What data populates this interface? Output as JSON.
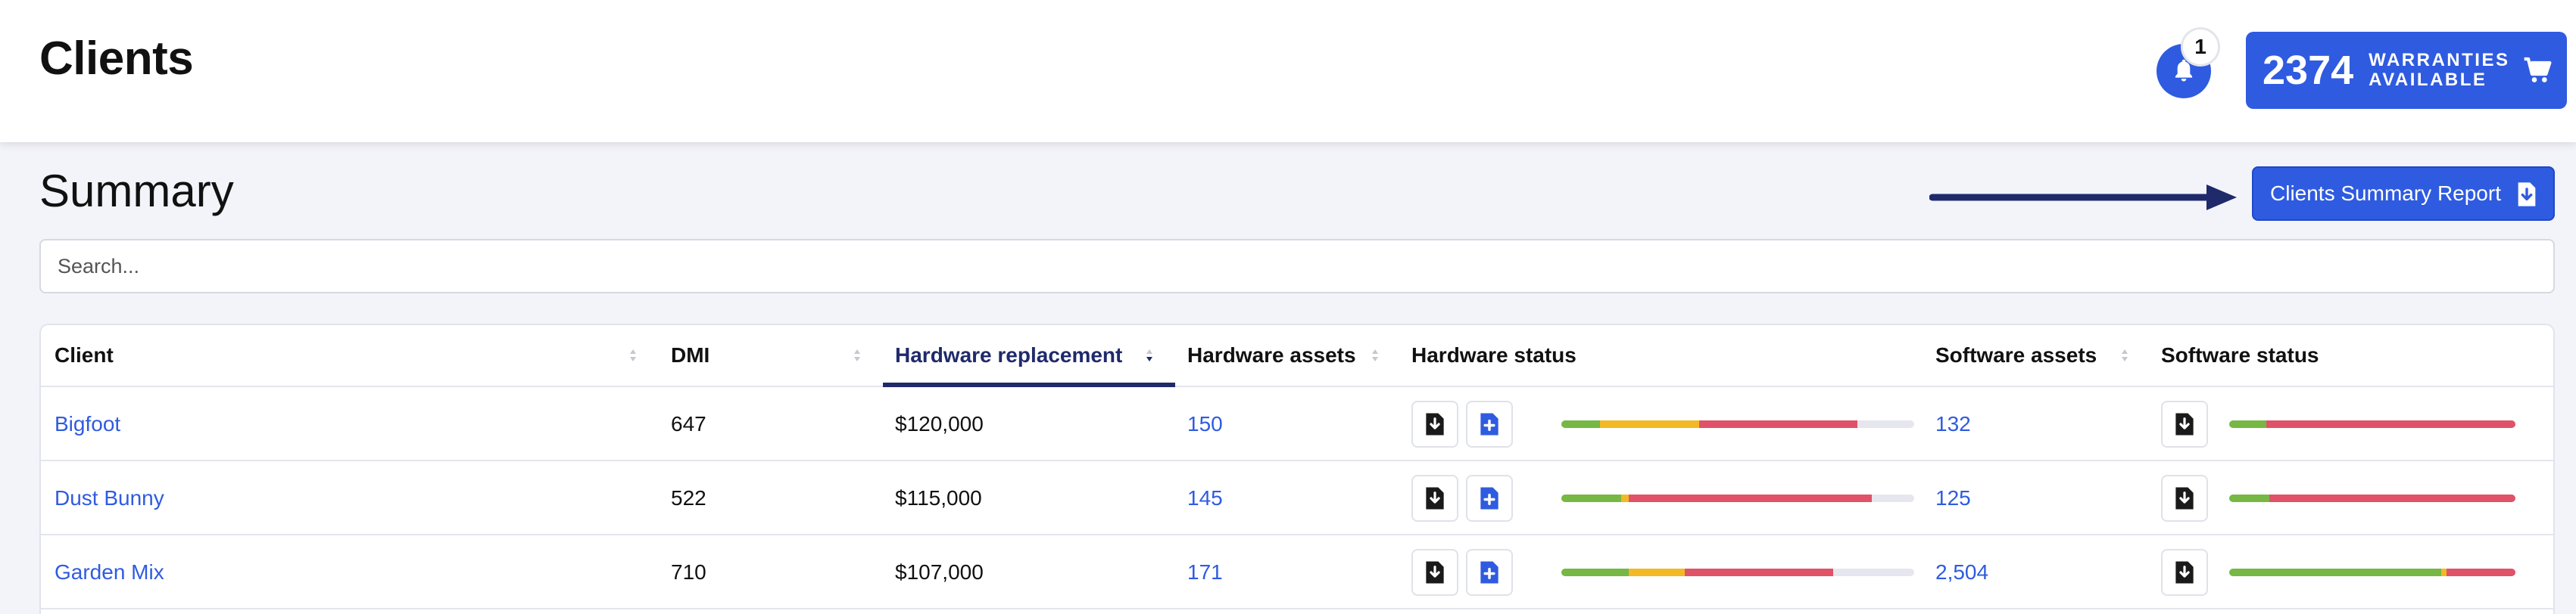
{
  "header": {
    "title": "Clients",
    "notifications": {
      "count": "1"
    }
  },
  "warranty": {
    "count": "2374",
    "label_line1": "WARRANTIES",
    "label_line2": "AVAILABLE"
  },
  "summary": {
    "title": "Summary",
    "report_button": "Clients Summary Report"
  },
  "search": {
    "placeholder": "Search..."
  },
  "table": {
    "columns": [
      "Client",
      "DMI",
      "Hardware replacement",
      "Hardware assets",
      "Hardware status",
      "Software assets",
      "Software status"
    ],
    "sorted_column": "Hardware replacement",
    "rows": [
      {
        "client": "Bigfoot",
        "dmi": "647",
        "hw_replacement": "$120,000",
        "hw_assets": "150",
        "sw_assets": "132",
        "hw_status": [
          {
            "color": "#76b843",
            "pct": 11
          },
          {
            "color": "#f2b925",
            "pct": 28
          },
          {
            "color": "#e05268",
            "pct": 45
          }
        ],
        "sw_status": [
          {
            "color": "#76b843",
            "pct": 13
          },
          {
            "color": "#e05268",
            "pct": 87
          }
        ]
      },
      {
        "client": "Dust Bunny",
        "dmi": "522",
        "hw_replacement": "$115,000",
        "hw_assets": "145",
        "sw_assets": "125",
        "hw_status": [
          {
            "color": "#76b843",
            "pct": 17
          },
          {
            "color": "#f2b925",
            "pct": 2
          },
          {
            "color": "#e05268",
            "pct": 69
          }
        ],
        "sw_status": [
          {
            "color": "#76b843",
            "pct": 14
          },
          {
            "color": "#e05268",
            "pct": 86
          }
        ]
      },
      {
        "client": "Garden Mix",
        "dmi": "710",
        "hw_replacement": "$107,000",
        "hw_assets": "171",
        "sw_assets": "2,504",
        "hw_status": [
          {
            "color": "#76b843",
            "pct": 19
          },
          {
            "color": "#f2b925",
            "pct": 16
          },
          {
            "color": "#e05268",
            "pct": 42
          }
        ],
        "sw_status": [
          {
            "color": "#76b843",
            "pct": 74
          },
          {
            "color": "#f2b925",
            "pct": 2
          },
          {
            "color": "#e05268",
            "pct": 24
          }
        ]
      }
    ]
  },
  "icons": {
    "bell": "bell-icon",
    "cart": "cart-icon",
    "report": "document-download-icon",
    "download": "download-icon",
    "add": "add-document-icon",
    "sort": "sort-icon"
  },
  "colors": {
    "accent": "#2f5be0",
    "dark_navy": "#1f2a6b",
    "green": "#76b843",
    "yellow": "#f2b925",
    "red": "#e05268"
  }
}
